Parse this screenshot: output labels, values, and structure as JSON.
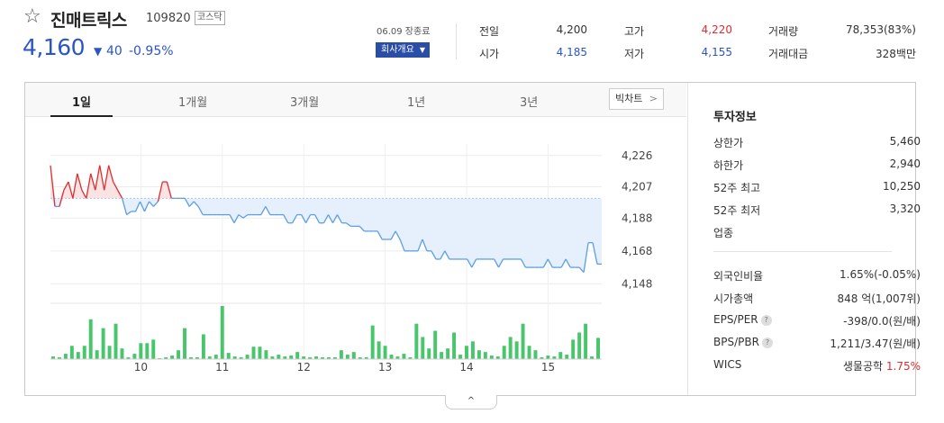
{
  "header": {
    "star_icon": "star-outline-icon",
    "name": "진매트릭스",
    "code": "109820",
    "market": "코스닥",
    "price": "4,160",
    "change_arrow": "▼",
    "change_amount": "40",
    "change_percent": "-0.95%",
    "trade_time": "06.09 장종료",
    "company_button": "회사개요"
  },
  "quotes": [
    {
      "label": "전일",
      "value": "4,200",
      "color": "#333333"
    },
    {
      "label": "시가",
      "value": "4,185",
      "color": "#2a55c8"
    },
    {
      "label": "고가",
      "value": "4,220",
      "color": "#e02d2d"
    },
    {
      "label": "저가",
      "value": "4,155",
      "color": "#2a55c8"
    },
    {
      "label": "거래량",
      "value": "78,353(83%)",
      "color": "#333333"
    },
    {
      "label": "거래대금",
      "value": "328백만",
      "color": "#333333"
    }
  ],
  "tabs": [
    {
      "label": "1일",
      "active": true
    },
    {
      "label": "1개월",
      "active": false
    },
    {
      "label": "3개월",
      "active": false
    },
    {
      "label": "1년",
      "active": false
    },
    {
      "label": "3년",
      "active": false
    }
  ],
  "big_chart_button": "빅차트",
  "info": {
    "title": "투자정보",
    "upper_limit": {
      "label": "상한가",
      "value": "5,460"
    },
    "lower_limit": {
      "label": "하한가",
      "value": "2,940"
    },
    "week52_high": {
      "label": "52주 최고",
      "value": "10,250"
    },
    "week52_low": {
      "label": "52주 최저",
      "value": "3,320"
    },
    "sector": {
      "label": "업종"
    },
    "foreign_ratio": {
      "label": "외국인비율",
      "value": "1.65%",
      "value2": "(-0.05%)"
    },
    "market_cap": {
      "label": "시가총액",
      "value": "848",
      "value2": "억(1,007위)"
    },
    "eps_per": {
      "label": "EPS/PER",
      "value": "-398/0.0",
      "value2": "(원/배)"
    },
    "bps_pbr": {
      "label": "BPS/PBR",
      "value": "1,211/3.47",
      "value2": "(원/배)"
    },
    "wics": {
      "label": "WICS",
      "value": "생물공학",
      "value2": "1.75%"
    }
  },
  "colors": {
    "up": "#e02d2d",
    "down": "#2a55c8",
    "line_below": "#5b9ee6",
    "fill_below": "#e6f0fc",
    "fill_above": "#fbe3e3",
    "volume": "#49c56b",
    "base": "#a9c4ea"
  },
  "chart_data": {
    "type": "line",
    "base_price": 4200,
    "ylim": [
      4140,
      4233
    ],
    "yticks": [
      4148,
      4168,
      4188,
      4207,
      4226
    ],
    "ytick_labels": [
      "4,148",
      "4,168",
      "4,188",
      "4,207",
      "4,226"
    ],
    "x_labels": [
      "10",
      "11",
      "12",
      "13",
      "14",
      "15"
    ],
    "x_label_index": [
      13,
      26,
      39,
      52,
      65,
      78
    ],
    "n_slots": 88,
    "price": [
      4220,
      4195,
      4195,
      4205,
      4210,
      4200,
      4215,
      4205,
      4200,
      4215,
      4205,
      4220,
      4205,
      4220,
      4210,
      4205,
      4200,
      4190,
      4192,
      4192,
      4198,
      4192,
      4198,
      4195,
      4198,
      4210,
      4210,
      4200,
      4200,
      4200,
      4200,
      4195,
      4198,
      4195,
      4190,
      4190,
      4190,
      4190,
      4190,
      4190,
      4190,
      4185,
      4190,
      4188,
      4190,
      4190,
      4190,
      4190,
      4195,
      4190,
      4190,
      4190,
      4190,
      4185,
      4185,
      4190,
      4190,
      4185,
      4190,
      4190,
      4185,
      4185,
      4190,
      4185,
      4190,
      4185,
      4185,
      4183,
      4183,
      4183,
      4180,
      4180,
      4180,
      4180,
      4175,
      4175,
      4175,
      4180,
      4175,
      4168,
      4168,
      4168,
      4168,
      4175,
      4168,
      4168,
      4163,
      4163,
      4168,
      4163,
      4163,
      4163,
      4163,
      4163,
      4158,
      4163,
      4163,
      4163,
      4163,
      4163,
      4158,
      4163,
      4163,
      4163,
      4163,
      4163,
      4158,
      4158,
      4158,
      4158,
      4158,
      4163,
      4158,
      4158,
      4158,
      4163,
      4158,
      4158,
      4158,
      4155,
      4173,
      4173,
      4160,
      4160
    ],
    "volume": [
      3,
      2,
      6,
      15,
      8,
      15,
      45,
      10,
      35,
      15,
      40,
      12,
      2,
      6,
      18,
      18,
      22,
      1,
      2,
      4,
      10,
      35,
      2,
      2,
      28,
      3,
      5,
      60,
      7,
      3,
      2,
      5,
      14,
      14,
      10,
      3,
      5,
      3,
      4,
      8,
      3,
      2,
      3,
      2,
      2,
      2,
      10,
      5,
      8,
      2,
      2,
      38,
      20,
      15,
      5,
      3,
      6,
      2,
      40,
      25,
      12,
      32,
      8,
      12,
      30,
      5,
      15,
      20,
      10,
      8,
      4,
      3,
      15,
      25,
      20,
      40,
      15,
      10,
      2,
      4,
      3,
      8,
      5,
      22,
      30,
      40,
      3,
      24
    ]
  }
}
